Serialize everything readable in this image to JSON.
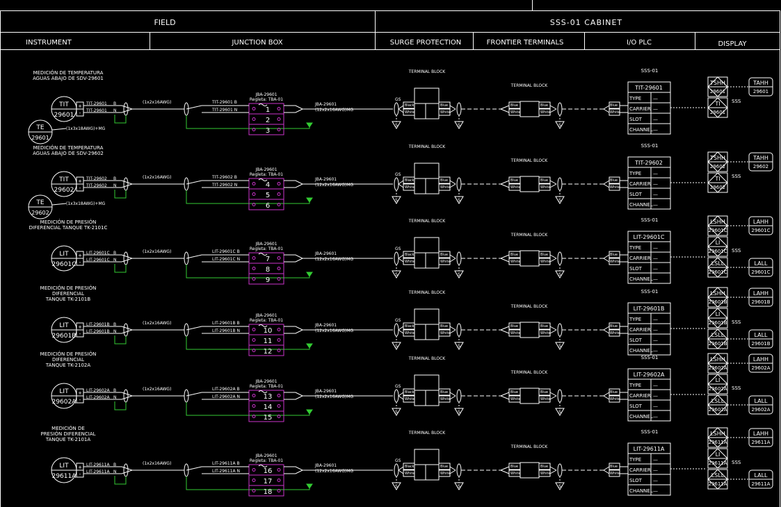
{
  "header": {
    "field": "FIELD",
    "cabinet": "SSS-01 CABINET",
    "columns": [
      "INSTRUMENT",
      "JUNCTION BOX",
      "SURGE PROTECTION",
      "FRONTIER TERMINALS",
      "I/O PLC",
      "DISPLAY"
    ]
  },
  "common": {
    "jb_title": "JBA-29601",
    "jb_sub": "Regleta: TBA-01",
    "surge_title": "TERMINAL BLOCK",
    "frontier_title": "TERMINAL BLOCK",
    "plc_title": "SSS-01",
    "plc_rows": [
      "TYPE",
      "CARRIER",
      "SLOT",
      "CHANNEL"
    ],
    "plc_dash": "—",
    "sss": "SSS",
    "cable_field": "(1x2x16AWG)",
    "cable_home_1": "JBA-29601",
    "cable_home_2": "(12x2x16AWG)MG",
    "te_cable": "(1x3x18AWG)+MG",
    "plus": "+",
    "minus": "-",
    "b": "B",
    "n": "N",
    "gs": "GS",
    "black": "Black",
    "white": "White",
    "blue": "Blue"
  },
  "loops": [
    {
      "desc": [
        "MEDICIÓN DE TEMPERATURA",
        "AGUAS ABAJO DE SDV-29601"
      ],
      "tag1": "TIT",
      "tag2": "29601",
      "te": [
        "TE",
        "29601"
      ],
      "wire1": "TIT-29601",
      "wire2": "TIT-29601",
      "terms": [
        "1",
        "2",
        "3"
      ],
      "plc": "TIT-29601",
      "displays": [
        {
          "code": "TSHH",
          "num": "29601",
          "alarm": "TAHH",
          "anum": "29601"
        },
        {
          "code": "TI",
          "num": "29601"
        }
      ]
    },
    {
      "desc": [
        "MEDICIÓN DE TEMPERATURA",
        "AGUAS ABAJO DE SDV-29602"
      ],
      "tag1": "TIT",
      "tag2": "29602",
      "te": [
        "TE",
        "29602"
      ],
      "wire1": "TIT-29602",
      "wire2": "TIT-29602",
      "terms": [
        "4",
        "5",
        "6"
      ],
      "plc": "TIT-29602",
      "displays": [
        {
          "code": "TSHH",
          "num": "29602",
          "alarm": "TAHH",
          "anum": "29602"
        },
        {
          "code": "TI",
          "num": "29602"
        }
      ]
    },
    {
      "desc": [
        "MEDICIÓN DE PRESIÓN",
        "DIFERENCIAL TANQUE TK-2101C"
      ],
      "tag1": "LIT",
      "tag2": "29601C",
      "te": null,
      "wire1": "LIT-29601C",
      "wire2": "LIT-29601C",
      "terms": [
        "7",
        "8",
        "9"
      ],
      "plc": "LIT-29601C",
      "displays": [
        {
          "code": "LSHH",
          "num": "29601C",
          "alarm": "LAHH",
          "anum": "29601C"
        },
        {
          "code": "LI",
          "num": "29601C"
        },
        {
          "code": "LSLL",
          "num": "29601C",
          "alarm": "LALL",
          "anum": "29601C"
        }
      ]
    },
    {
      "desc": [
        "MEDICIÓN DE PRESIÓN",
        "DIFERENCIAL",
        "TANQUE TK-2101B"
      ],
      "tag1": "LIT",
      "tag2": "29601B",
      "te": null,
      "wire1": "LIT-29601B",
      "wire2": "LIT-29601B",
      "terms": [
        "10",
        "11",
        "12"
      ],
      "plc": "LIT-29601B",
      "displays": [
        {
          "code": "LSHH",
          "num": "29601B",
          "alarm": "LAHH",
          "anum": "29601B"
        },
        {
          "code": "LI",
          "num": "29601B"
        },
        {
          "code": "LSLL",
          "num": "29601B",
          "alarm": "LALL",
          "anum": "29601B"
        }
      ]
    },
    {
      "desc": [
        "MEDICIÓN DE PRESIÓN",
        "DIFERENCIAL",
        "TANQUE TK-2102A"
      ],
      "tag1": "LIT",
      "tag2": "29602A",
      "te": null,
      "wire1": "LIT-29602A",
      "wire2": "LIT-29602A",
      "terms": [
        "13",
        "14",
        "15"
      ],
      "plc": "LIT-29602A",
      "displays": [
        {
          "code": "LSHH",
          "num": "29602A",
          "alarm": "LAHH",
          "anum": "29602A"
        },
        {
          "code": "LI",
          "num": "29602A"
        },
        {
          "code": "LSLL",
          "num": "29602A",
          "alarm": "LALL",
          "anum": "29602A"
        }
      ]
    },
    {
      "desc": [
        "MEDICIÓN DE",
        "PRESIÓN DIFERENCIAL",
        "TANQUE TK-2101A"
      ],
      "tag1": "LIT",
      "tag2": "29611A",
      "te": null,
      "wire1": "LIT-29611A",
      "wire2": "LIT-29611A",
      "terms": [
        "16",
        "17",
        "18"
      ],
      "plc": "LIT-29611A",
      "displays": [
        {
          "code": "LSHH",
          "num": "29611A",
          "alarm": "LAHH",
          "anum": "29611A"
        },
        {
          "code": "LI",
          "num": "29611A"
        },
        {
          "code": "LSLL",
          "num": "29611A",
          "alarm": "LALL",
          "anum": "29611A"
        }
      ]
    }
  ]
}
